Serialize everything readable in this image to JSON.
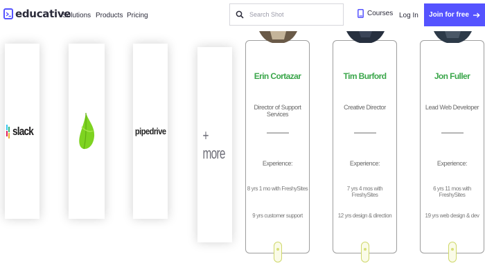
{
  "nav": {
    "brand": "educative",
    "links": [
      "Solutions",
      "Products",
      "Pricing"
    ],
    "search_placeholder": "Search Shot",
    "courses": "Courses",
    "login": "Log In",
    "join": "Join for free",
    "join_icon": "arrow-right-icon",
    "accent_color": "#5553ff"
  },
  "logos": {
    "slack": "slack",
    "pipedrive": "pipedrive",
    "more": "+ more"
  },
  "profiles": [
    {
      "name": "Erin Cortazar",
      "title": "Director of Support Services",
      "experience_label": "Experience:",
      "line1": "8 yrs 1 mo with FreshySites",
      "line2": "9 yrs customer support"
    },
    {
      "name": "Tim Burford",
      "title": "Creative Director",
      "experience_label": "Experience:",
      "line1": "7 yrs 4 mos with FreshySites",
      "line2": "12 yrs design & direction"
    },
    {
      "name": "Jon Fuller",
      "title": "Lead Web Developer",
      "experience_label": "Experience:",
      "line1": "6 yrs 11 mos with FreshySites",
      "line2": "19 yrs web design & dev"
    }
  ],
  "colors": {
    "name_green": "#3aa64a"
  }
}
